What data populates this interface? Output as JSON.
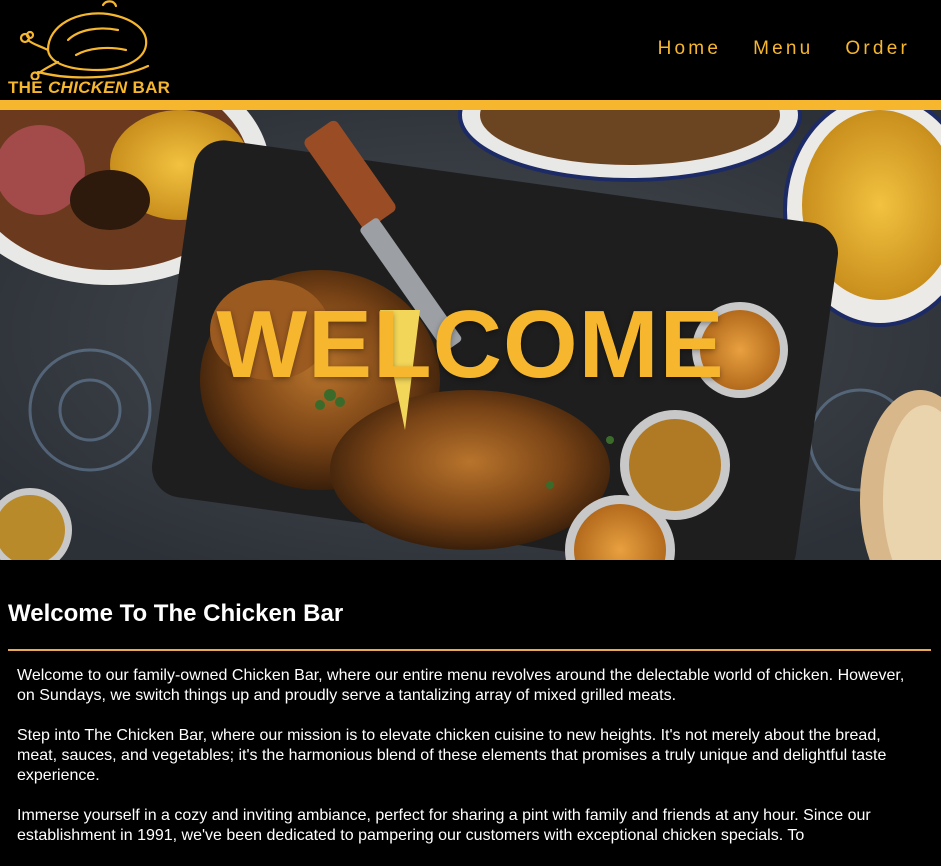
{
  "logo": {
    "text_pre": "THE ",
    "text_em": "CHICKEN",
    "text_post": " BAR"
  },
  "nav": {
    "items": [
      {
        "label": "Home"
      },
      {
        "label": "Menu"
      },
      {
        "label": "Order"
      }
    ]
  },
  "hero": {
    "title": "WELCOME"
  },
  "main": {
    "title": "Welcome To The Chicken Bar",
    "paragraphs": [
      "Welcome to our family-owned Chicken Bar, where our entire menu revolves around the delectable world of chicken. However, on Sundays, we switch things up and proudly serve a tantalizing array of mixed grilled meats.",
      "Step into The Chicken Bar, where our mission is to elevate chicken cuisine to new heights. It's not merely about the bread, meat, sauces, and vegetables; it's the harmonious blend of these elements that promises a truly unique and delightful taste experience.",
      "Immerse yourself in a cozy and inviting ambiance, perfect for sharing a pint with family and friends at any hour. Since our establishment in 1991, we've been dedicated to pampering our customers with exceptional chicken specials. To"
    ]
  },
  "colors": {
    "accent": "#f6b72f",
    "divider": "#e8a855",
    "background": "#000000"
  }
}
